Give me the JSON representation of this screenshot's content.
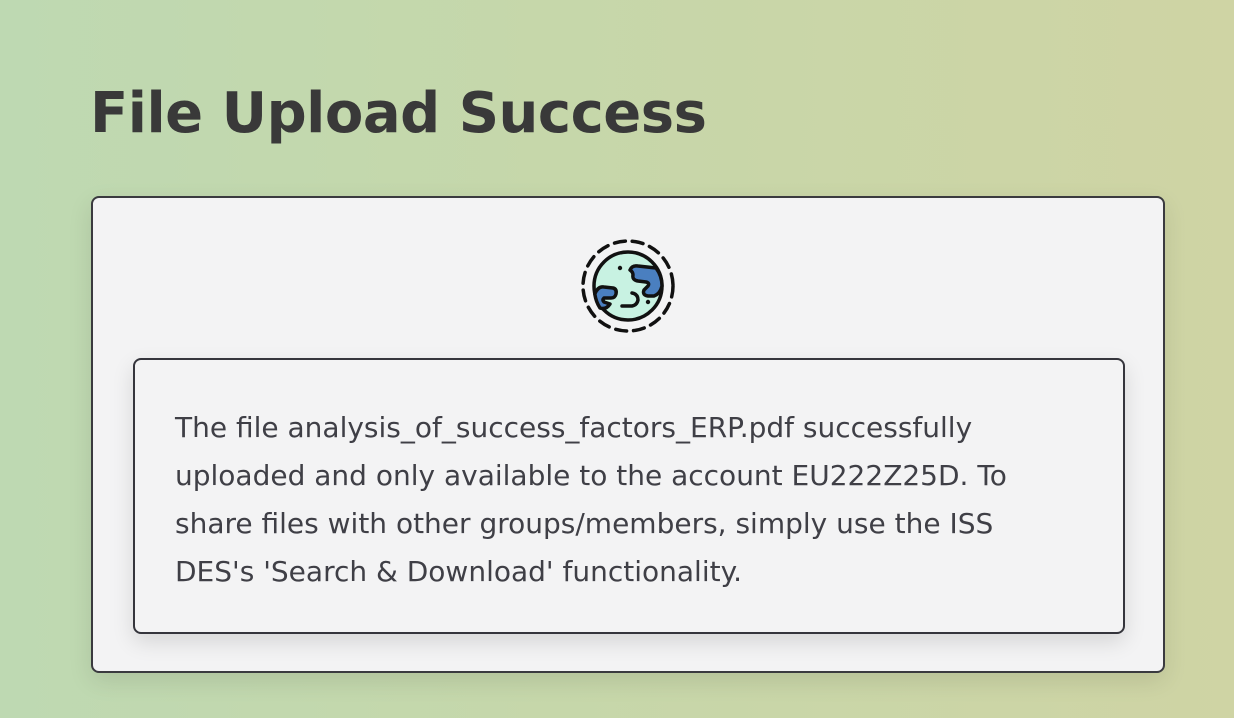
{
  "page": {
    "title": "File Upload Success"
  },
  "card": {
    "icon": "globe-icon",
    "message": "The file analysis_of_success_factors_ERP.pdf successfully uploaded and only available to the account EU222Z25D. To share files with other groups/members, simply use the ISS DES's 'Search & Download' functionality."
  },
  "colors": {
    "background_start": "#bed9b2",
    "background_end": "#cfd4a4",
    "card_background": "#f3f3f4",
    "border": "#3a3a3f",
    "globe_water": "#c8f2e2",
    "globe_land": "#4a7fc0",
    "title_text": "#393939",
    "body_text": "#3f3f46"
  }
}
